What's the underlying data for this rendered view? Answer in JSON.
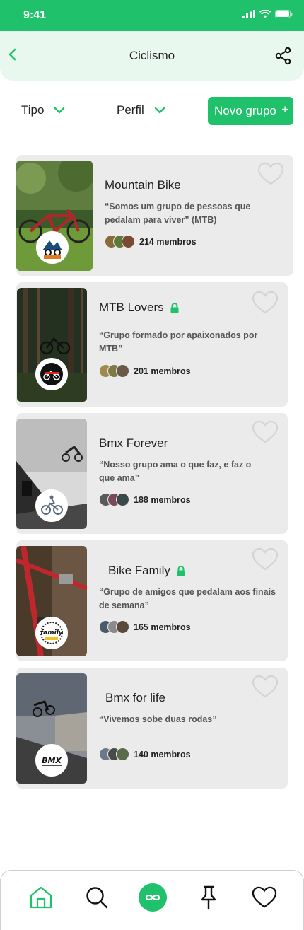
{
  "status_bar": {
    "time": "9:41"
  },
  "header": {
    "title": "Ciclismo"
  },
  "filters": {
    "type_label": "Tipo",
    "profile_label": "Perfil",
    "new_group_label": "Novo grupo",
    "new_group_plus": "+"
  },
  "colors": {
    "accent": "#1fc26a",
    "header_bg": "#e9f8ef",
    "card_bg": "#ebebec"
  },
  "groups": [
    {
      "name": "Mountain Bike",
      "locked": false,
      "description": "“Somos um grupo de pessoas que pedalam para viver” (MTB)",
      "members": "214 membros",
      "logo": "mountain-bike-logo",
      "favorite": false
    },
    {
      "name": "MTB Lovers",
      "locked": true,
      "description": "“Grupo formado por apaixonados por MTB”",
      "members": "201 membros",
      "logo": "mtb-lovers-logo",
      "favorite": false
    },
    {
      "name": "Bmx Forever",
      "locked": false,
      "description": "“Nosso grupo ama o que faz, e faz o que ama”",
      "members": "188 membros",
      "logo": "bmx-forever-logo",
      "favorite": false
    },
    {
      "name": "Bike Family",
      "locked": true,
      "description": "“Grupo de amigos que pedalam aos finais de semana”",
      "members": "165 membros",
      "logo": "bike-family-logo",
      "favorite": false
    },
    {
      "name": "Bmx for life",
      "locked": false,
      "description": "“Vivemos sobe duas rodas”",
      "members": "140 membros",
      "logo": "bmx-logo",
      "favorite": false
    }
  ],
  "bottom_nav": [
    {
      "name": "home",
      "icon": "home-icon",
      "active": false
    },
    {
      "name": "search",
      "icon": "search-icon",
      "active": false
    },
    {
      "name": "groups",
      "icon": "infinity-icon",
      "active": true
    },
    {
      "name": "pinned",
      "icon": "pin-icon",
      "active": false
    },
    {
      "name": "favorites",
      "icon": "heart-icon",
      "active": false
    }
  ]
}
